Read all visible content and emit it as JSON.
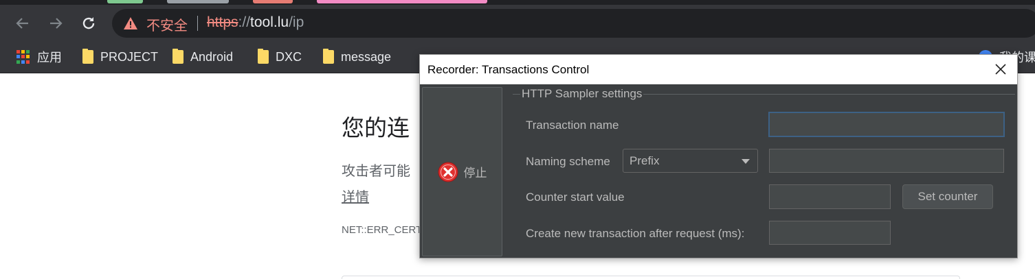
{
  "browser": {
    "tab_chip_colors": [
      "#7ec98f",
      "#9aa0a6",
      "#e67c73",
      "#f28bc4"
    ],
    "security_label": "不安全",
    "url_scheme": "https",
    "url_sep": "://",
    "url_host": "tool.lu",
    "url_path": "/ip",
    "bookmarks": [
      {
        "label": "应用",
        "icon": "apps-icon"
      },
      {
        "label": "PROJECT",
        "icon": "folder-icon"
      },
      {
        "label": "Android",
        "icon": "folder-icon"
      },
      {
        "label": "DXC",
        "icon": "folder-icon"
      },
      {
        "label": "message",
        "icon": "folder-icon"
      }
    ],
    "bookmark_partial_right": "我的课"
  },
  "page": {
    "heading": "您的连",
    "body_text": "攻击者可能",
    "details_link": "详情",
    "error_code": "NET::ERR_CERT"
  },
  "dialog": {
    "title": "Recorder: Transactions Control",
    "stop_label": "停止",
    "section_legend": "HTTP Sampler settings",
    "transaction_name_label": "Transaction name",
    "transaction_name_value": "",
    "naming_scheme_label": "Naming scheme",
    "naming_scheme_value": "Prefix",
    "naming_scheme_text_value": "",
    "counter_start_label": "Counter start value",
    "counter_start_value": "",
    "set_counter_label": "Set counter",
    "new_transaction_label": "Create new transaction after request (ms):",
    "new_transaction_value": ""
  },
  "colors": {
    "chrome_dark": "#35363a",
    "insecure_red": "#f28b82",
    "darcula_bg": "#3c3f41",
    "focus_blue": "#3d6185",
    "stop_red": "#e0312f"
  }
}
